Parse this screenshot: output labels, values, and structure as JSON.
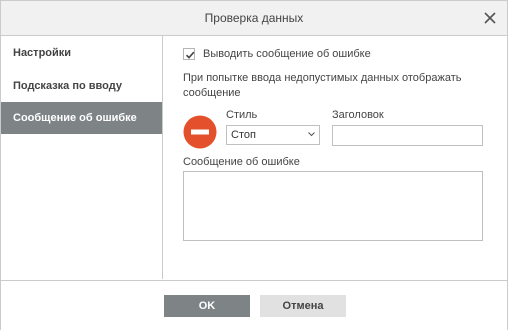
{
  "dialog": {
    "title": "Проверка данных"
  },
  "sidebar": {
    "items": [
      {
        "label": "Настройки",
        "active": false
      },
      {
        "label": "Подсказка по вводу",
        "active": false
      },
      {
        "label": "Сообщение об ошибке",
        "active": true
      }
    ]
  },
  "error_tab": {
    "show_error_checkbox": {
      "label": "Выводить сообщение об ошибке",
      "checked": true
    },
    "hint_text": "При попытке ввода недопустимых данных отображать сообщение",
    "style": {
      "label": "Стиль",
      "value": "Стоп",
      "icon": "stop-icon"
    },
    "title_field": {
      "label": "Заголовок",
      "value": ""
    },
    "message_field": {
      "label": "Сообщение об ошибке",
      "value": ""
    }
  },
  "footer": {
    "ok_label": "OK",
    "cancel_label": "Отмена"
  },
  "colors": {
    "accent": "#7e8486",
    "stop_red": "#e3502b"
  }
}
